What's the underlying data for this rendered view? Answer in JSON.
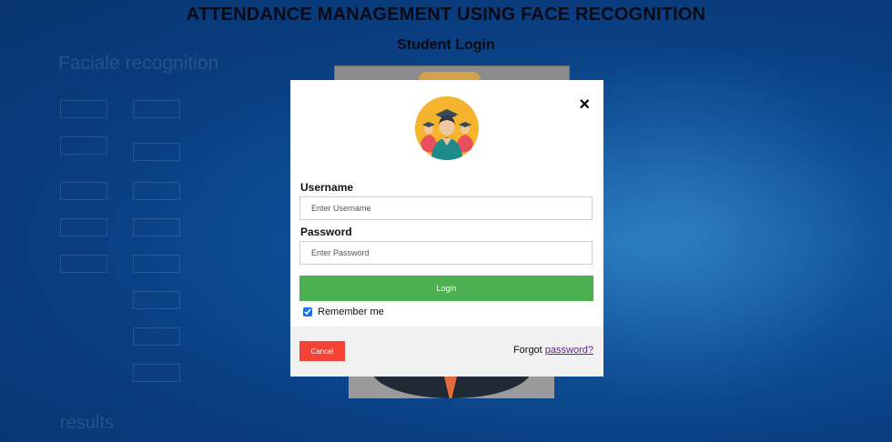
{
  "page": {
    "title": "ATTENDANCE MANAGEMENT USING FACE RECOGNITION",
    "subtitle": "Student Login"
  },
  "background": {
    "heading": "Faciale recognition",
    "footer_text": "results",
    "colors": {
      "dark": "#083570",
      "mid": "#0e4f97",
      "light": "#1f6fb8"
    }
  },
  "modal": {
    "close_icon": "×",
    "avatar_icon": "graduate-students-icon",
    "username": {
      "label": "Username",
      "placeholder": "Enter Username",
      "value": ""
    },
    "password": {
      "label": "Password",
      "placeholder": "Enter Password",
      "value": ""
    },
    "login_label": "Login",
    "remember": {
      "label": "Remember me",
      "checked": true
    },
    "cancel_label": "Cancel",
    "forgot_prefix": "Forgot",
    "forgot_link": "password?",
    "colors": {
      "login": "#4caf50",
      "cancel": "#f44336",
      "link": "#5b2a86",
      "footer_bg": "#f1f1f1"
    }
  }
}
